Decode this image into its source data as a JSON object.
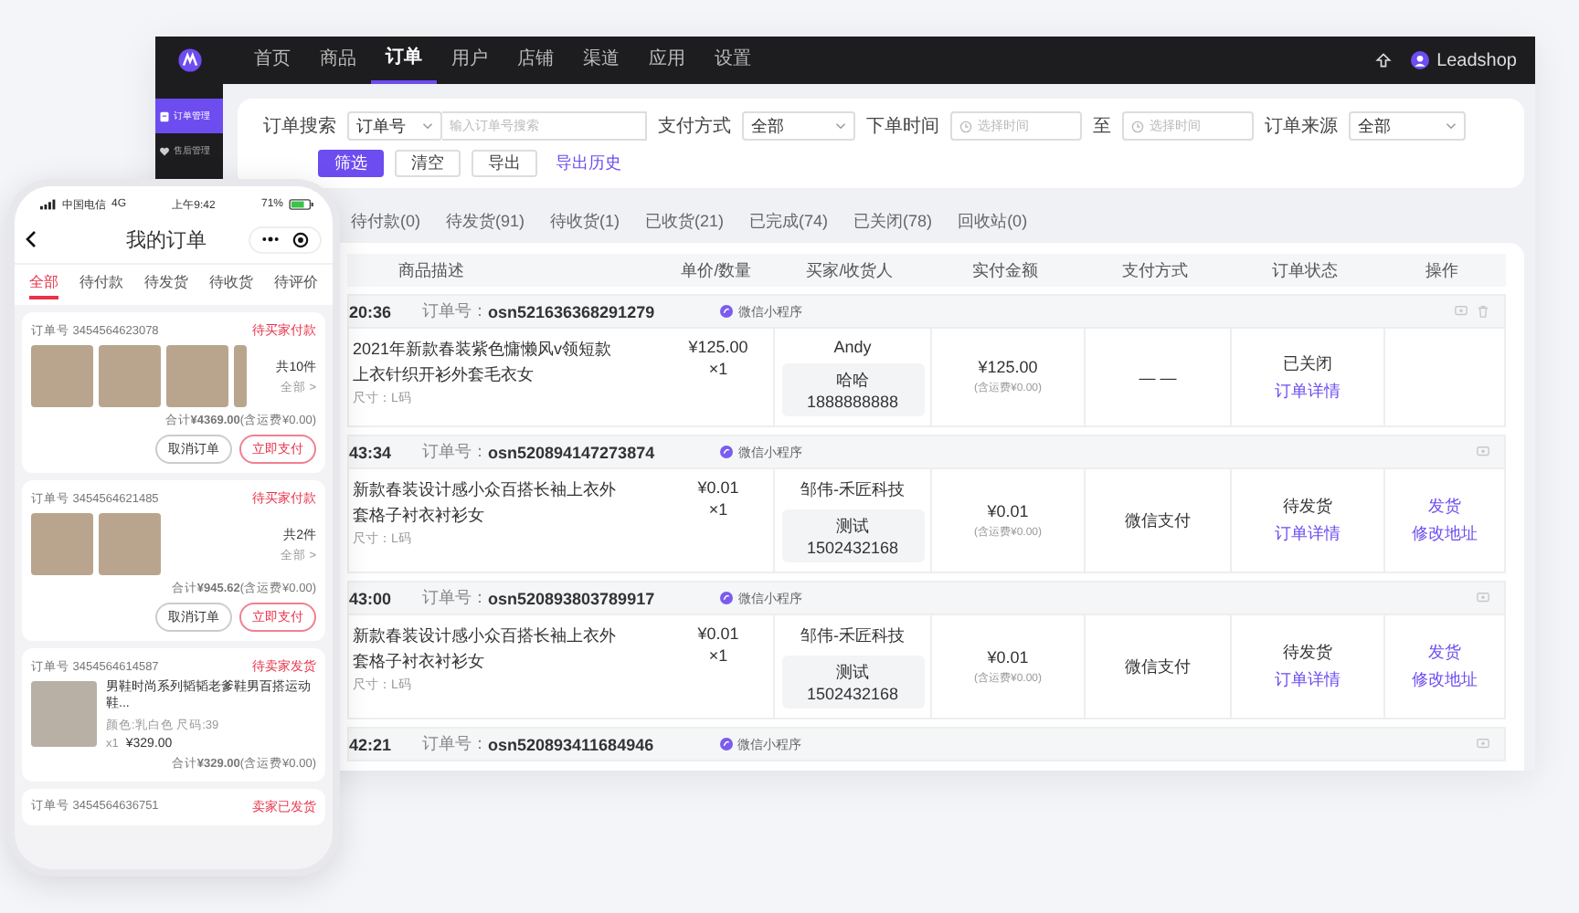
{
  "topbar": {
    "nav": [
      {
        "label": "首页",
        "selected": false
      },
      {
        "label": "商品",
        "selected": false
      },
      {
        "label": "订单",
        "selected": true
      },
      {
        "label": "用户",
        "selected": false
      },
      {
        "label": "店铺",
        "selected": false
      },
      {
        "label": "渠道",
        "selected": false
      },
      {
        "label": "应用",
        "selected": false
      },
      {
        "label": "设置",
        "selected": false
      }
    ],
    "user": "Leadshop"
  },
  "sidebar": [
    {
      "label": "订单管理",
      "selected": true,
      "kind": "orders"
    },
    {
      "label": "售后管理",
      "selected": false,
      "kind": "aftersale"
    }
  ],
  "filters": {
    "search_label": "订单搜索",
    "search_type": "订单号",
    "search_placeholder": "输入订单号搜索",
    "pay_label": "支付方式",
    "pay_value": "全部",
    "time_label": "下单时间",
    "time_from_placeholder": "选择时间",
    "time_sep": "至",
    "time_to_placeholder": "选择时间",
    "source_label": "订单来源",
    "source_value": "全部",
    "buttons": [
      {
        "label": "筛选",
        "kind": "primary"
      },
      {
        "label": "清空",
        "kind": "default"
      },
      {
        "label": "导出",
        "kind": "default"
      },
      {
        "label": "导出历史",
        "kind": "link"
      }
    ]
  },
  "tabs": [
    {
      "label": "待付款(0)",
      "selected": false
    },
    {
      "label": "待发货(91)",
      "selected": false
    },
    {
      "label": "待收货(1)",
      "selected": false
    },
    {
      "label": "已收货(21)",
      "selected": false
    },
    {
      "label": "已完成(74)",
      "selected": false
    },
    {
      "label": "已关闭(78)",
      "selected": false
    },
    {
      "label": "回收站(0)",
      "selected": false
    }
  ],
  "table": {
    "columns": [
      "商品描述",
      "单价/数量",
      "买家/收货人",
      "实付金额",
      "支付方式",
      "订单状态",
      "操作"
    ],
    "orders": [
      {
        "time": "20:36",
        "number_label": "订单号：",
        "number": "osn521636368291279",
        "source": "微信小程序",
        "deletable": true,
        "body": {
          "desc": [
            "2021年新款春装紫色慵懒风v领短款",
            "上衣针织开衫外套毛衣女"
          ],
          "spec": "尺寸：L码",
          "price": "¥125.00",
          "qty": "×1",
          "buyer": "Andy",
          "receiver": "哈哈",
          "phone": "1888888888",
          "amount": "¥125.00",
          "freight": "(含运费¥0.00)",
          "payment": "— —",
          "status": "已关闭",
          "detail": "订单详情"
        }
      },
      {
        "time": "43:34",
        "number_label": "订单号：",
        "number": "osn520894147273874",
        "source": "微信小程序",
        "deletable": false,
        "body": {
          "desc": [
            "新款春装设计感小众百搭长袖上衣外",
            "套格子衬衣衬衫女"
          ],
          "spec": "尺寸：L码",
          "price": "¥0.01",
          "qty": "×1",
          "buyer": "邹伟-禾匠科技",
          "receiver": "测试",
          "phone": "1502432168",
          "amount": "¥0.01",
          "freight": "(含运费¥0.00)",
          "payment": "微信支付",
          "status": "待发货",
          "detail": "订单详情",
          "ops": [
            "发货",
            "修改地址"
          ]
        }
      },
      {
        "time": "43:00",
        "number_label": "订单号：",
        "number": "osn520893803789917",
        "source": "微信小程序",
        "deletable": false,
        "body": {
          "desc": [
            "新款春装设计感小众百搭长袖上衣外",
            "套格子衬衣衬衫女"
          ],
          "spec": "尺寸：L码",
          "price": "¥0.01",
          "qty": "×1",
          "buyer": "邹伟-禾匠科技",
          "receiver": "测试",
          "phone": "1502432168",
          "amount": "¥0.01",
          "freight": "(含运费¥0.00)",
          "payment": "微信支付",
          "status": "待发货",
          "detail": "订单详情",
          "ops": [
            "发货",
            "修改地址"
          ]
        }
      },
      {
        "time": "42:21",
        "number_label": "订单号：",
        "number": "osn520893411684946",
        "source": "微信小程序",
        "deletable": false
      }
    ]
  },
  "phone": {
    "carrier": "中国电信",
    "network": "4G",
    "clock": "上午9:42",
    "battery": "71%",
    "title": "我的订单",
    "tabs": [
      {
        "label": "全部",
        "selected": true
      },
      {
        "label": "待付款",
        "selected": false
      },
      {
        "label": "待发货",
        "selected": false
      },
      {
        "label": "待收货",
        "selected": false
      },
      {
        "label": "待评价",
        "selected": false
      }
    ],
    "orders": [
      {
        "number": "订单号 3454564623078",
        "status": "待买家付款",
        "images": [
          {
            "cropped": false
          },
          {
            "cropped": false
          },
          {
            "cropped": false
          },
          {
            "cropped": true
          }
        ],
        "count": "共10件",
        "all": "全部 >",
        "total": "合计**¥4369.00**(含运费¥0.00)",
        "buttons": [
          {
            "label": "取消订单",
            "kind": "default"
          },
          {
            "label": "立即支付",
            "kind": "primary"
          }
        ]
      },
      {
        "number": "订单号 3454564621485",
        "status": "待买家付款",
        "images": [
          {
            "cropped": false
          },
          {
            "cropped": false
          }
        ],
        "count": "共2件",
        "all": "全部 >",
        "total": "合计**¥945.62**(含运费¥0.00)",
        "buttons": [
          {
            "label": "取消订单",
            "kind": "default"
          },
          {
            "label": "立即支付",
            "kind": "primary"
          }
        ]
      },
      {
        "number": "订单号 3454564614587",
        "status": "待卖家发货",
        "product": {
          "title": "男鞋时尚系列韬韬老爹鞋男百搭运动鞋...",
          "spec": "颜色:乳白色 尺码:39",
          "qty": "x1",
          "price": "¥329.00"
        },
        "total": "合计**¥329.00**(含运费¥0.00)"
      },
      {
        "number": "订单号 3454564636751",
        "status": "卖家已发货"
      }
    ]
  }
}
